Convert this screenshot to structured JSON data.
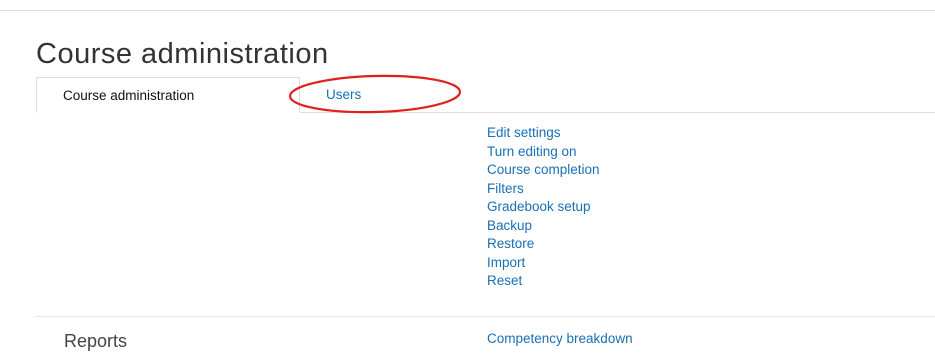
{
  "page": {
    "title": "Course administration"
  },
  "tabs": [
    {
      "label": "Course administration",
      "active": true
    },
    {
      "label": "Users",
      "active": false,
      "highlighted": true
    }
  ],
  "colors": {
    "link": "#1a6fb5",
    "annotation": "#e0201b",
    "title": "#333333"
  },
  "menu": {
    "items": [
      {
        "label": "Edit settings"
      },
      {
        "label": "Turn editing on"
      },
      {
        "label": "Course completion"
      },
      {
        "label": "Filters"
      },
      {
        "label": "Gradebook setup"
      },
      {
        "label": "Backup"
      },
      {
        "label": "Restore"
      },
      {
        "label": "Import"
      },
      {
        "label": "Reset"
      }
    ]
  },
  "reports": {
    "heading": "Reports",
    "items": [
      {
        "label": "Competency breakdown"
      }
    ]
  }
}
